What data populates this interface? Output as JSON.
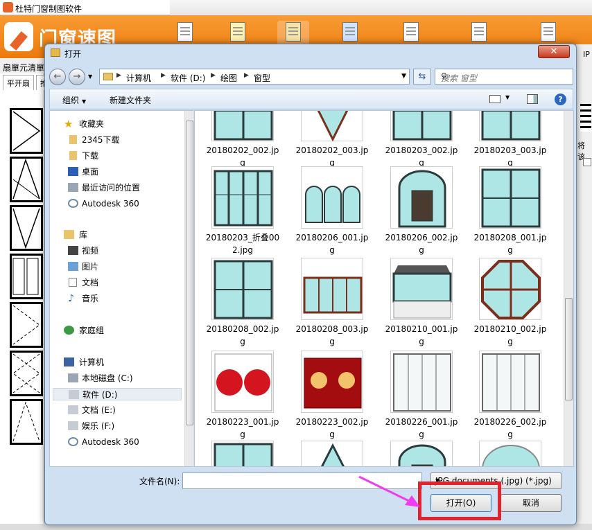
{
  "app": {
    "title": "杜特门窗制图软件",
    "logo_text": "门窗速图",
    "menu_left": "扇單元清單",
    "tabs": [
      "平开扇",
      "推"
    ],
    "right_text": [
      "IP",
      "将该"
    ]
  },
  "dialog": {
    "title": "打开",
    "close_glyph": "✕",
    "breadcrumbs": [
      "计算机",
      "软件 (D:)",
      "绘图",
      "窗型"
    ],
    "search_placeholder": "搜索 窗型",
    "commands": {
      "organize": "组织",
      "new_folder": "新建文件夹"
    },
    "nav": {
      "favorites_header": "收藏夹",
      "favorites": [
        "2345下载",
        "下载",
        "桌面",
        "最近访问的位置",
        "Autodesk 360"
      ],
      "libraries_header": "库",
      "libraries": [
        "视频",
        "图片",
        "文档",
        "音乐"
      ],
      "homegroup": "家庭组",
      "computer_header": "计算机",
      "drives": [
        "本地磁盘 (C:)",
        "软件 (D:)",
        "文档 (E:)",
        "娱乐 (F:)",
        "Autodesk 360"
      ]
    },
    "files": [
      {
        "name": "20180202_002.jpg",
        "kind": "rect"
      },
      {
        "name": "20180202_003.jpg",
        "kind": "arch"
      },
      {
        "name": "20180203_002.jpg",
        "kind": "rect"
      },
      {
        "name": "20180203_003.jpg",
        "kind": "rect"
      },
      {
        "name": "20180203_折叠002.jpg",
        "kind": "fold"
      },
      {
        "name": "20180206_001.jpg",
        "kind": "arches"
      },
      {
        "name": "20180206_002.jpg",
        "kind": "doorarch"
      },
      {
        "name": "20180208_001.jpg",
        "kind": "rect"
      },
      {
        "name": "20180208_002.jpg",
        "kind": "rect"
      },
      {
        "name": "20180208_003.jpg",
        "kind": "wide"
      },
      {
        "name": "20180210_001.jpg",
        "kind": "bay"
      },
      {
        "name": "20180210_002.jpg",
        "kind": "octagon"
      },
      {
        "name": "20180223_001.jpg",
        "kind": "red"
      },
      {
        "name": "20180223_002.jpg",
        "kind": "red2"
      },
      {
        "name": "20180226_001.jpg",
        "kind": "grid"
      },
      {
        "name": "20180226_002.jpg",
        "kind": "grid"
      },
      {
        "name": "",
        "kind": "rect"
      },
      {
        "name": "",
        "kind": "triangle"
      },
      {
        "name": "",
        "kind": "doorarch"
      },
      {
        "name": "",
        "kind": "semi"
      }
    ],
    "filename_label": "文件名(N):",
    "filename_value": "",
    "filetype": "JPG documents (.jpg) (*.jpg)",
    "open_button": "打开(O)",
    "cancel_button": "取消"
  },
  "colors": {
    "accent": "#ec7a0c",
    "highlight": "#e0242e",
    "glass": "#aee6e6",
    "frame": "#2b3a3a",
    "wood": "#7a2e1c"
  }
}
